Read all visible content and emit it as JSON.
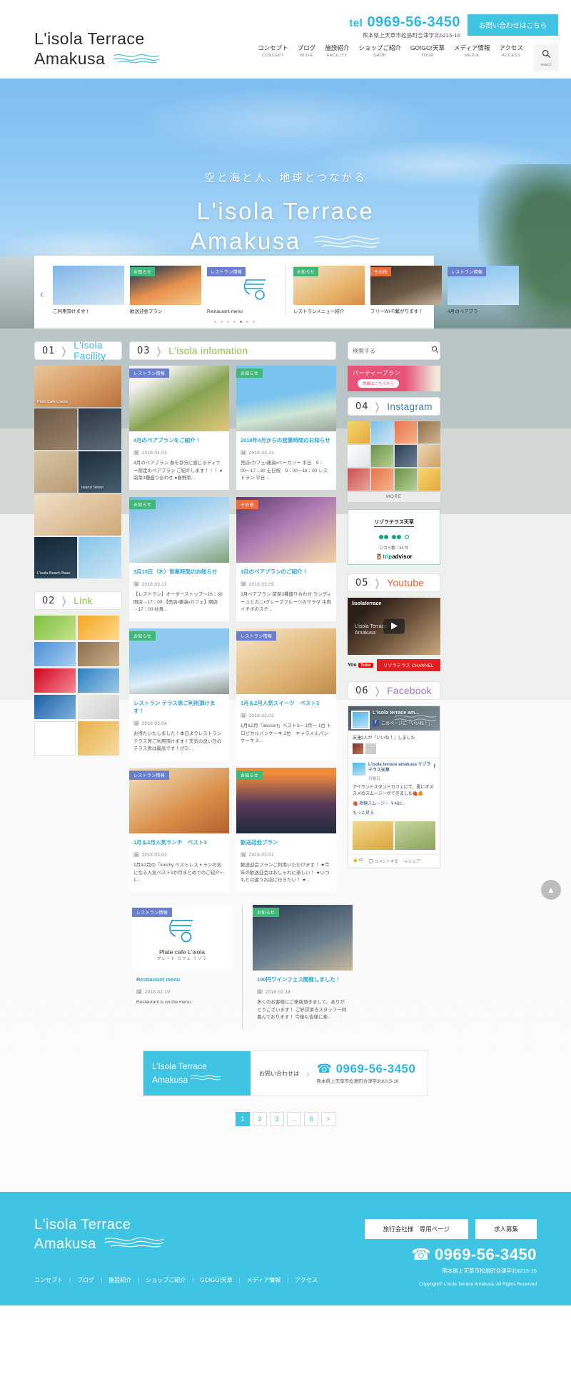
{
  "header": {
    "logo_line1": "L'isola Terrace",
    "logo_line2": "Amakusa",
    "tel_label": "tel",
    "tel_number": "0969-56-3450",
    "address": "熊本県上天草市松島町合津字北6215-16",
    "contact_button": "お問い合わせはこちら",
    "nav": [
      {
        "ja": "コンセプト",
        "en": "CONCEPT"
      },
      {
        "ja": "ブログ",
        "en": "BLOG"
      },
      {
        "ja": "施設紹介",
        "en": "FACILITY"
      },
      {
        "ja": "ショップご紹介",
        "en": "SHOP"
      },
      {
        "ja": "GO!GO!天草",
        "en": "TOUR"
      },
      {
        "ja": "メディア情報",
        "en": "MEDIA"
      },
      {
        "ja": "アクセス",
        "en": "ACCESS"
      }
    ],
    "search_label": "search"
  },
  "hero": {
    "tagline": "空と海と人、地球とつながる",
    "title_line1": "L'isola Terrace",
    "title_line2": "Amakusa"
  },
  "carousel": {
    "prev": "‹",
    "next": "›",
    "items": [
      {
        "badge": "",
        "badge_type": "none",
        "caption": "ご利用頂けます！",
        "art": "t1"
      },
      {
        "badge": "お知らせ",
        "badge_type": "info",
        "caption": "歓送迎会プラン",
        "art": "t2"
      },
      {
        "badge": "レストラン情報",
        "badge_type": "rest",
        "caption": "Restaurant menu",
        "art": "t3"
      },
      {
        "badge": "お知らせ",
        "badge_type": "info",
        "caption": "レストランメニュー紹介",
        "art": "t4"
      },
      {
        "badge": "その他",
        "badge_type": "other",
        "caption": "フリーWi-Fi繋がります！",
        "art": "t5"
      },
      {
        "badge": "レストラン情報",
        "badge_type": "rest",
        "caption": "4月のペアプラ",
        "art": "t6"
      }
    ]
  },
  "sections": {
    "facility": {
      "num": "01",
      "name": "L'isola Facility"
    },
    "link": {
      "num": "02",
      "name": "Link"
    },
    "information": {
      "num": "03",
      "name": "L'isola infomation"
    },
    "instagram": {
      "num": "04",
      "name": "Instagram"
    },
    "youtube": {
      "num": "05",
      "name": "Youtube"
    },
    "facebook": {
      "num": "06",
      "name": "Facebook"
    }
  },
  "search": {
    "placeholder": "検索する"
  },
  "facility_tiles": [
    {
      "caption": "Plate Cafe L'isola",
      "art": "f1"
    },
    {
      "caption": "",
      "art": "f2"
    },
    {
      "caption": "",
      "art": "f3"
    },
    {
      "caption": "",
      "art": "f4"
    },
    {
      "caption": "Island Street",
      "art": "f5"
    },
    {
      "caption": "",
      "art": "f6"
    },
    {
      "caption": "L'isola Beach Base",
      "art": "f7"
    },
    {
      "caption": "",
      "art": "f8"
    }
  ],
  "link_tiles": [
    "l1",
    "l2",
    "l3",
    "l4",
    "l5",
    "l6",
    "l7",
    "l8",
    "l9",
    "l10"
  ],
  "party_banner": {
    "title": "パーティープラン",
    "sub": "詳細はこちらから"
  },
  "instagram_more": "MORE",
  "tripadvisor": {
    "name": "リゾラテラス天草",
    "reviews": "口コミ数：34 件",
    "logo_a": "trip",
    "logo_b": "advisor"
  },
  "youtube": {
    "username": "lisolaterrace",
    "overlay_line1": "L'isola Terrace",
    "overlay_line2": "Amakusa",
    "logo_you": "You",
    "logo_tube": "Tube",
    "cta": "リゾラテラス CHANNEL"
  },
  "facebook": {
    "page_name": "L'isola terrace am...",
    "like_text": "このページに「いいね！」",
    "friends_text": "友達2人が「いいね！」しました",
    "post_name": "L'isola terrace amakusa リゾラテラス天草",
    "post_date": "月曜日",
    "post_text": "アイランドスタンドカフェにて、夏にオススメのスムージーができました🍓🍊",
    "post_link": "🍓 燃糖スムージー ￥480...",
    "post_more": "もっと見る",
    "actions": [
      "👍 42",
      "💬 コメントする",
      "↪ シェア"
    ]
  },
  "news_cards": [
    {
      "badge": "レストラン情報",
      "badge_type": "rest",
      "art": "i1",
      "title": "4月のペアプランをご紹介！",
      "date": "2018.04.03",
      "text": "4月のペアプラン 春を存分に感じるディナー限定のペアプラン ご紹介します！！！ ●前菜3種盛り合わせ ●春野菜..."
    },
    {
      "badge": "お知らせ",
      "badge_type": "info",
      "art": "i2",
      "title": "2018年4月からの営業時間のお知らせ",
      "date": "2018.03.21",
      "text": "売店・カフェ・雑貨・ベーカリー 平日　9：00〜17：30 土日祝　9：00〜18：00 レストラン 平日 ..."
    },
    {
      "badge": "お知らせ",
      "badge_type": "info",
      "art": "i3",
      "title": "3月15日（木）営業時間のお知らせ",
      "date": "2018.03.13",
      "text": "【レストラン】オーダーストップ〜16：30 閉店→17：00 【売店・雑貨・カフェ】閉店→17：00 社員..."
    },
    {
      "badge": "その他",
      "badge_type": "other",
      "art": "i4",
      "title": "3月のペアプランのご紹介！",
      "date": "2018.03.05",
      "text": "3月ペアプラン 前菜3種盛り合わせ ランディーユとカニ・グレープフルーツのサラダ 牛肉イチボのステ..."
    },
    {
      "badge": "お知らせ",
      "badge_type": "info",
      "art": "i5",
      "title": "レストラン テラス席ご利用頂けます！",
      "date": "2018.03.04",
      "text": "お得たいたしました！本日よりレストランテラス席ご利用頂けます！天気の良い日のテラス席は最高です！ぜひ..."
    },
    {
      "badge": "レストラン情報",
      "badge_type": "rest",
      "art": "i6",
      "title": "1月＆2月人気スイーツ　ベスト3",
      "date": "2018.03.02",
      "text": "1月&2月「dessert」ベスト3〜 1月〜 1位 トロピカルパンケーキ 2位　キャラメルパンケーキ 3..."
    },
    {
      "badge": "レストラン情報",
      "badge_type": "rest",
      "art": "i7",
      "title": "1月＆2月人気ランチ　ベスト3",
      "date": "2018.03.02",
      "text": "1月&2月の「lunchy ベストレストランの気になる人気ベスト3か月まとめでのご紹介〜1..."
    },
    {
      "badge": "お知らせ",
      "badge_type": "info",
      "art": "i8",
      "title": "歓送迎会プラン",
      "date": "2018.03.01",
      "text": "歓送迎会プランご利用いただけます！ ★今年の歓送迎会はおしゃれに楽しい！ ★いつもとは違うお店に行きたい！ ★..."
    }
  ],
  "wide_cards": [
    {
      "badge": "レストラン情報",
      "badge_type": "rest",
      "art": "i9",
      "title": "Restaurant menu",
      "date": "2018.02.19",
      "text": "Restaurant is on the menu.",
      "brand_line1": "Plate cafe L'isola",
      "brand_line2": "プレート カフェ リゾラ"
    },
    {
      "badge": "お知らせ",
      "badge_type": "info",
      "art": "i10",
      "title": "100円ワインフェス開催しました！",
      "date": "2018.02.18",
      "text": "多くのお客様にご来店頂きまして、ありがとうございます！ ご好評頂きスタッフ一同喜んでおります！ 今後も皆様に楽..."
    }
  ],
  "contact_strip": {
    "logo_line1": "L'isola Terrace",
    "logo_line2": "Amakusa",
    "label": "お問い合わせは",
    "chevron": "›",
    "tel": "0969-56-3450",
    "address": "熊本県上天草市松島町合津字北6215-16"
  },
  "pagination": {
    "pages": [
      "1",
      "2",
      "3",
      "…",
      "8",
      ">"
    ],
    "current": "1"
  },
  "footer": {
    "logo_line1": "L'isola Terrace",
    "logo_line2": "Amakusa",
    "buttons": [
      "旅行会社様　専用ページ",
      "求人募集"
    ],
    "nav": [
      "コンセプト",
      "ブログ",
      "施設紹介",
      "ショップご紹介",
      "GOIGO!天草",
      "メディア情報",
      "アクセス"
    ],
    "tel": "0969-56-3450",
    "address": "熊本県上天草市松島町合津字北6215-16",
    "copyright": "Copyright© L'isola Terrace Amakusa. All Rights Reserved"
  },
  "to_top": "▲"
}
